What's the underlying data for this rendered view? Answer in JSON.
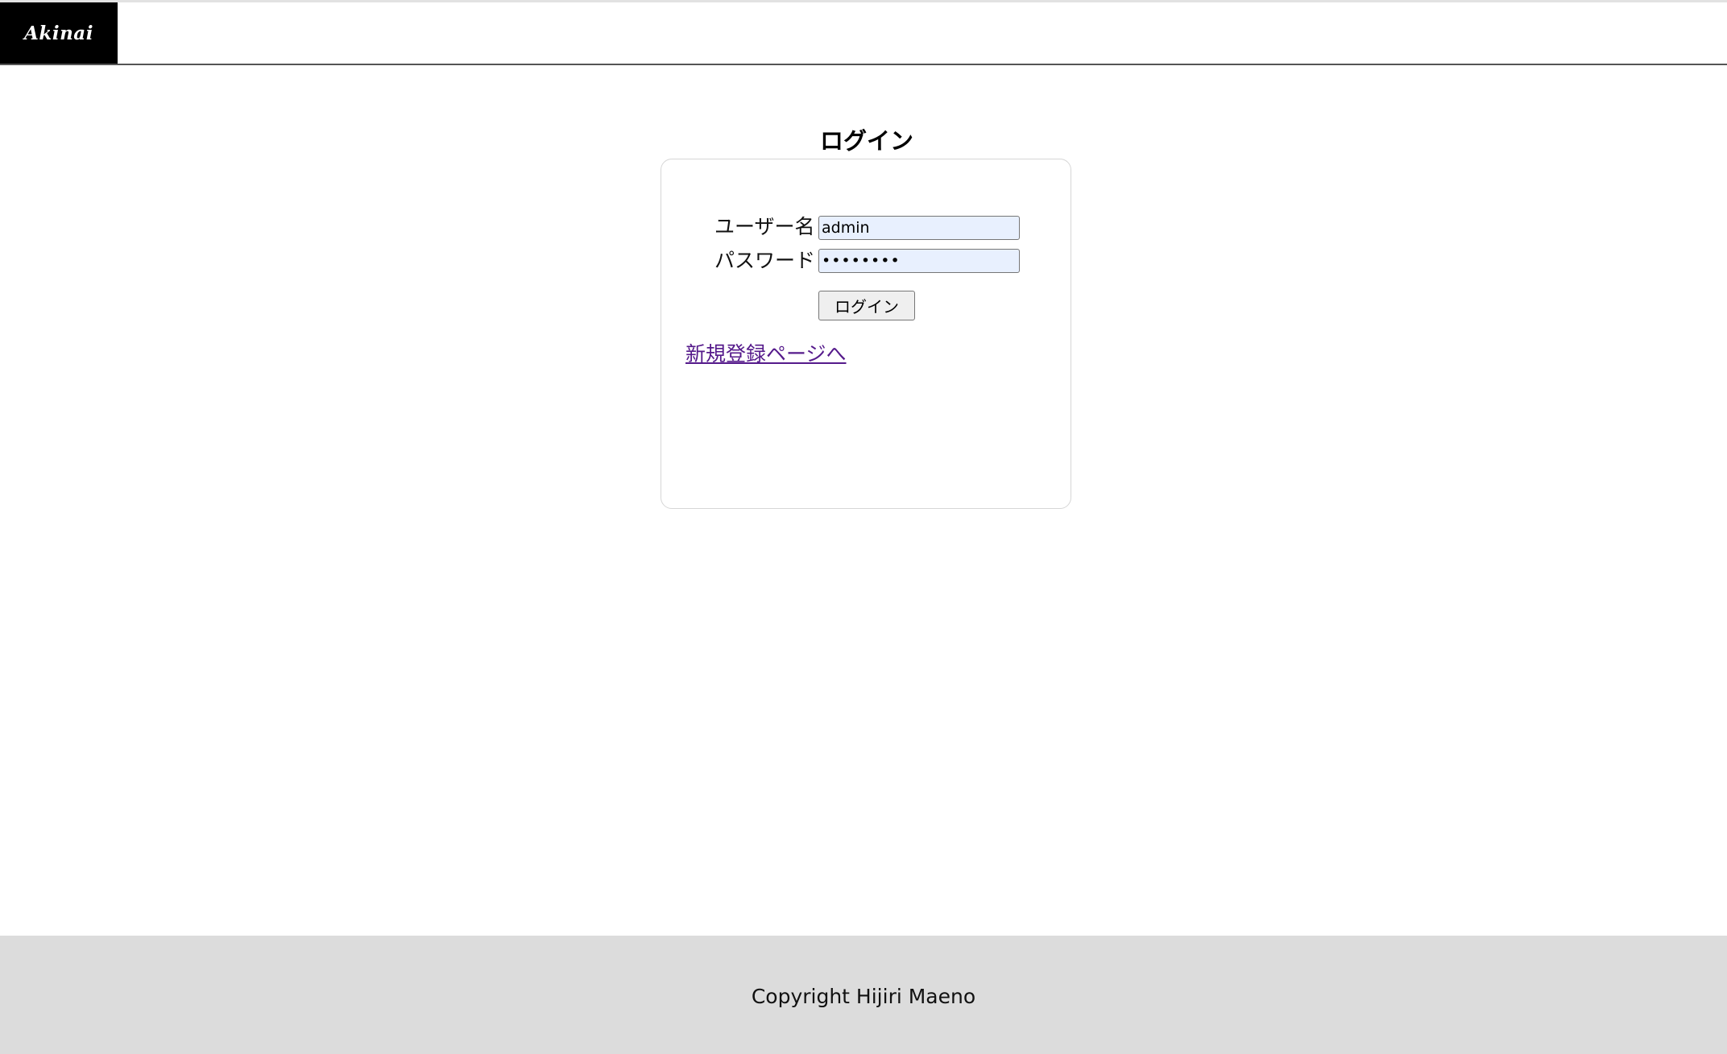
{
  "header": {
    "logo_text": "Akinai"
  },
  "login": {
    "title": "ログイン",
    "username_label": "ユーザー名",
    "username_value": "admin",
    "password_label": "パスワード",
    "password_value": "••••••••",
    "submit_label": "ログイン",
    "register_link": "新規登録ページへ"
  },
  "footer": {
    "copyright": "Copyright Hijiri Maeno"
  },
  "colors": {
    "header_logo_bg": "#000000",
    "input_autofill_bg": "#e8f0fe",
    "link_visited": "#551a8b",
    "footer_bg": "#dcdcdc"
  }
}
